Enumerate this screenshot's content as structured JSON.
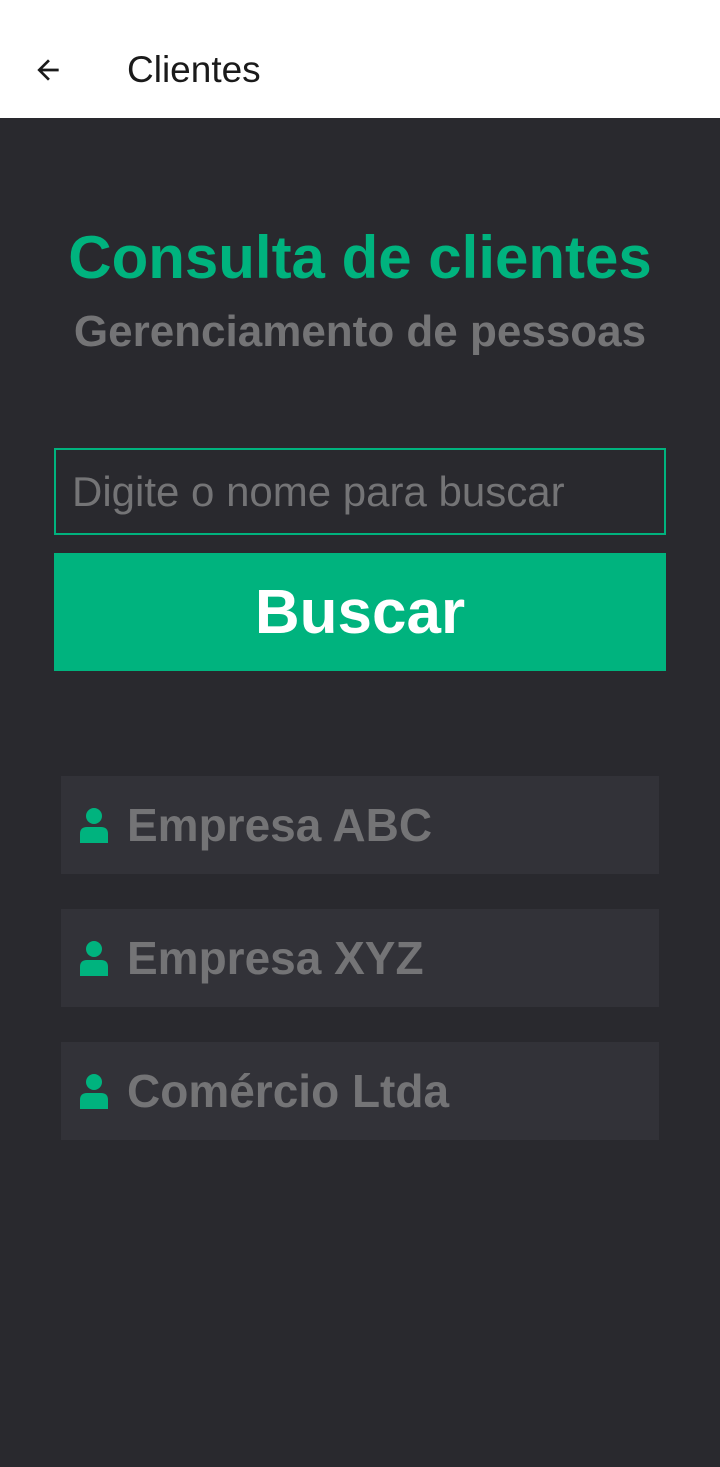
{
  "appbar": {
    "title": "Clientes",
    "back_icon": "arrow-left-icon"
  },
  "header": {
    "title": "Consulta de clientes",
    "subtitle": "Gerenciamento de pessoas"
  },
  "search": {
    "value": "",
    "placeholder": "Digite o nome para buscar",
    "button_label": "Buscar"
  },
  "clients": [
    {
      "name": "Empresa ABC",
      "icon": "user-icon"
    },
    {
      "name": "Empresa XYZ",
      "icon": "user-icon"
    },
    {
      "name": "Comércio Ltda",
      "icon": "user-icon"
    }
  ],
  "colors": {
    "accent": "#00b37e",
    "background": "#29292e",
    "card": "#323238",
    "muted_text": "#747476",
    "appbar": "#ffffff"
  }
}
